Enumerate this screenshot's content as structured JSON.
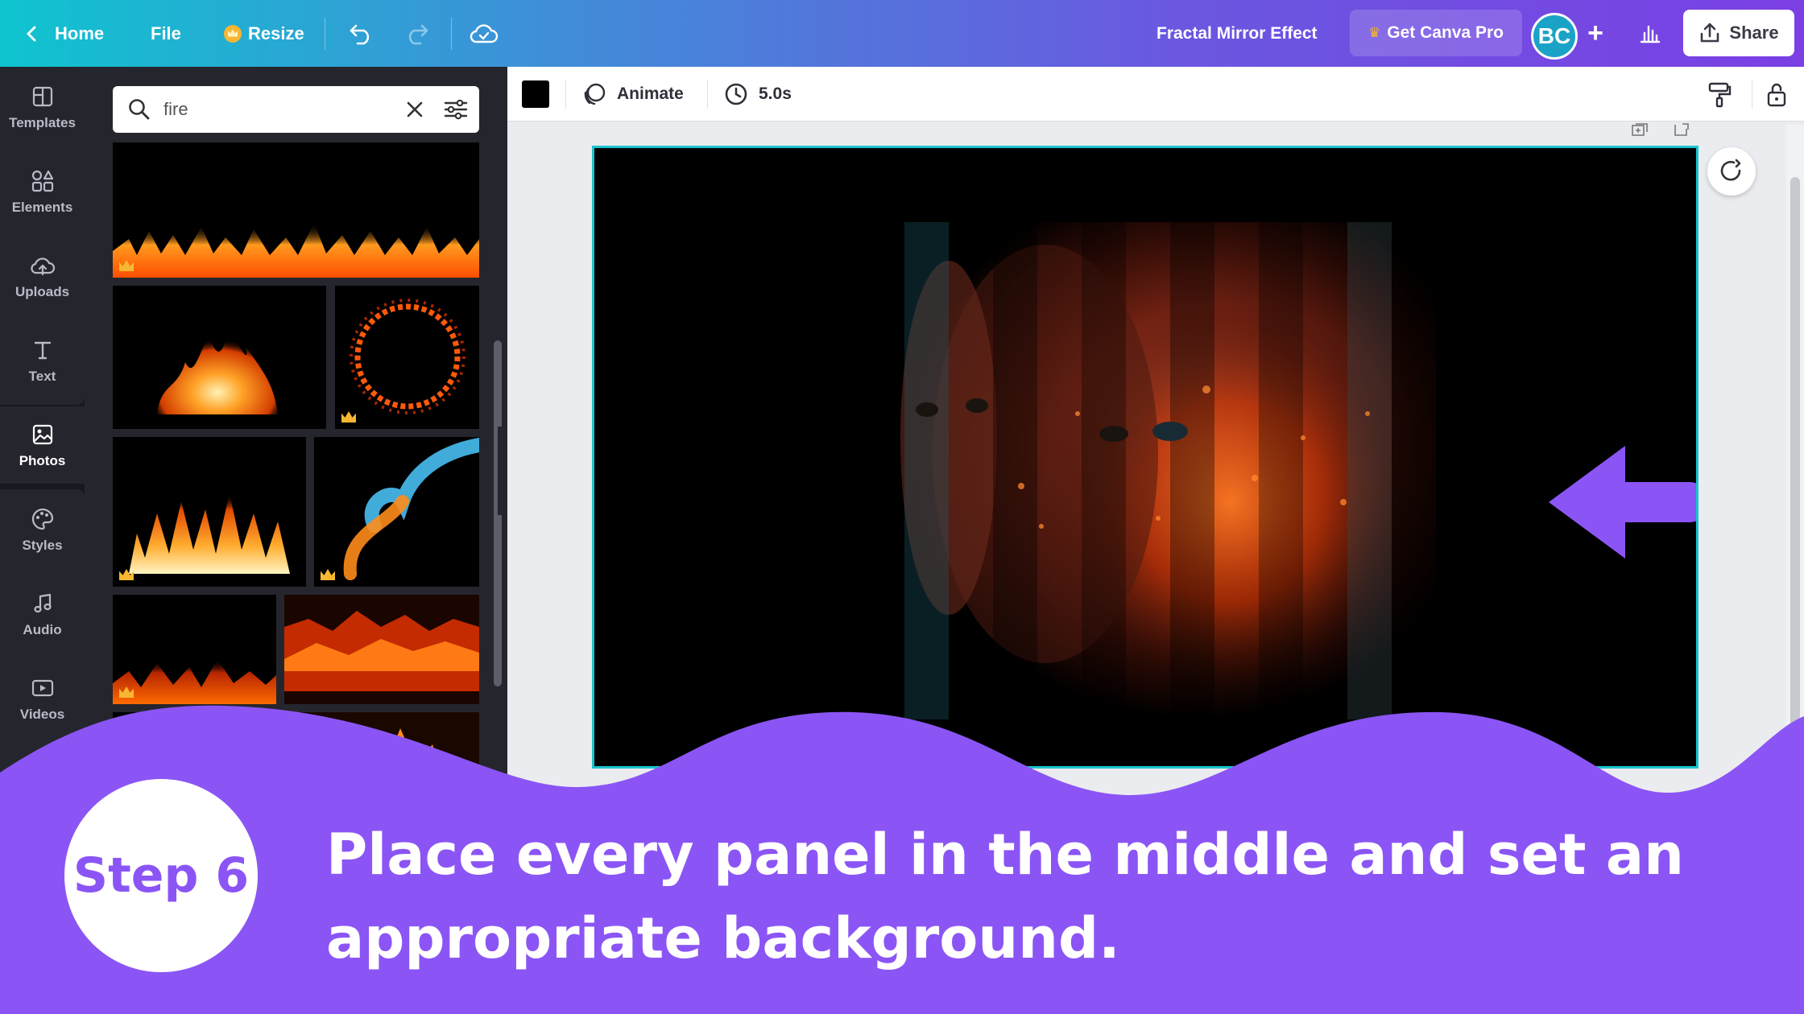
{
  "topbar": {
    "home_label": "Home",
    "file_label": "File",
    "resize_label": "Resize",
    "document_title": "Fractal Mirror Effect",
    "get_pro_label": "Get Canva Pro",
    "avatar_initials": "BC",
    "share_label": "Share"
  },
  "rail": {
    "items": [
      {
        "label": "Templates",
        "icon": "templates-icon"
      },
      {
        "label": "Elements",
        "icon": "elements-icon"
      },
      {
        "label": "Uploads",
        "icon": "uploads-icon"
      },
      {
        "label": "Text",
        "icon": "text-icon"
      },
      {
        "label": "Photos",
        "icon": "photos-icon"
      },
      {
        "label": "Styles",
        "icon": "styles-icon"
      },
      {
        "label": "Audio",
        "icon": "audio-icon"
      },
      {
        "label": "Videos",
        "icon": "videos-icon"
      }
    ],
    "active": "Photos"
  },
  "search": {
    "value": "fire"
  },
  "toolbar": {
    "animate_label": "Animate",
    "duration": "5.0s",
    "color_chip": "#000000"
  },
  "tutorial": {
    "step_label": "Step 6",
    "caption_line1": "Place every panel in the middle and set an",
    "caption_line2": "appropriate background."
  },
  "colors": {
    "accent_purple": "#8b55f5",
    "selection_teal": "#19c4cf",
    "panel_dark": "#25262d"
  }
}
